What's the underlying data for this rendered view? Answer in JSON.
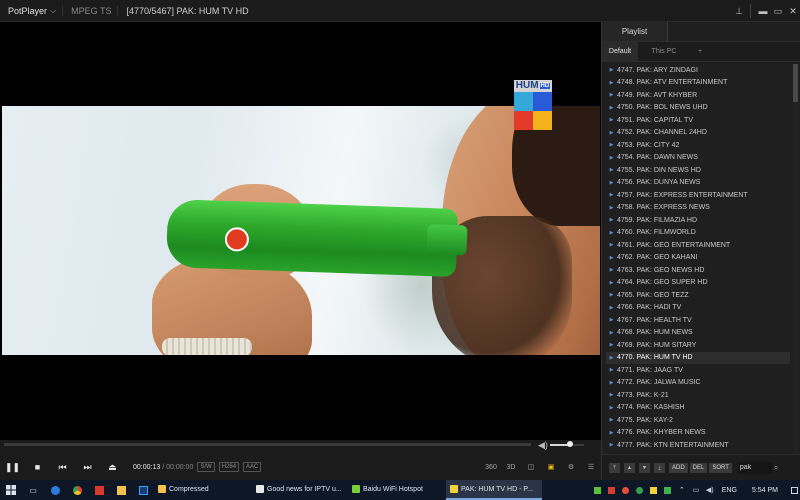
{
  "window": {
    "app_name": "PotPlayer",
    "format": "MPEG TS",
    "title": "[4770/5467] PAK: HUM TV HD",
    "controls_icons": [
      "pin-icon",
      "minimize-icon",
      "maximize-icon",
      "close-icon"
    ]
  },
  "video": {
    "channel_logo_text": "HUM",
    "channel_logo_hd": "HD",
    "seek_progress": 0.0,
    "volume_level": 0.6
  },
  "controls": {
    "current_time": "00:00:13",
    "duration": "/ 00:00:00",
    "badge_sw": "S/W",
    "badge_codec": "H264",
    "badge_audio": "AAC",
    "right_icons": [
      "360",
      "3D",
      "⚙",
      "☰"
    ]
  },
  "playlist": {
    "tab_label": "Playlist",
    "sub_tabs": [
      "Default",
      "This PC",
      "+"
    ],
    "items": [
      "4747. PAK: ARY ZINDAGI",
      "4748. PAK: ATV ENTERTAINMENT",
      "4749. PAK: AVT KHYBER",
      "4750. PAK: BOL NEWS UHD",
      "4751. PAK: CAPITAL TV",
      "4752. PAK: CHANNEL 24HD",
      "4753. PAK: CITY 42",
      "4754. PAK: DAWN NEWS",
      "4755. PAK: DIN NEWS HD",
      "4756. PAK: DUNYA NEWS",
      "4757. PAK: EXPRESS ENTERTAINMENT",
      "4758. PAK: EXPRESS NEWS",
      "4759. PAK: FILMAZIA HD",
      "4760. PAK: FILMWORLD",
      "4761. PAK: GEO ENTERTAINMENT",
      "4762. PAK: GEO KAHANI",
      "4763. PAK: GEO NEWS HD",
      "4764. PAK: GEO SUPER HD",
      "4765. PAK: GEO TEZZ",
      "4766. PAK: HADI TV",
      "4767. PAK: HEALTH TV",
      "4768. PAK: HUM NEWS",
      "4769. PAK: HUM SITARY",
      "4770. PAK: HUM TV HD",
      "4771. PAK: JAAG TV",
      "4772. PAK: JALWA MUSIC",
      "4773. PAK: K-21",
      "4774. PAK: KASHISH",
      "4775. PAK: KAY-2",
      "4776. PAK: KHYBER NEWS",
      "4777. PAK: KTN ENTERTAINMENT"
    ],
    "selected_index": 23,
    "footer_buttons": [
      "ADD",
      "DEL",
      "SORT"
    ],
    "search_value": "pak"
  },
  "taskbar": {
    "tasks": [
      {
        "label": "Compressed",
        "color": "#f2c14e"
      },
      {
        "label": "Good news for IPTV u...",
        "color": "#e8e8e8"
      },
      {
        "label": "Baidu WiFi Hotspot",
        "color": "#7ccf3c"
      },
      {
        "label": "PAK: HUM TV HD - P...",
        "color": "#f2d23c"
      }
    ],
    "language": "ENG",
    "clock": "5:54 PM",
    "accent": "#7aa7e0"
  }
}
